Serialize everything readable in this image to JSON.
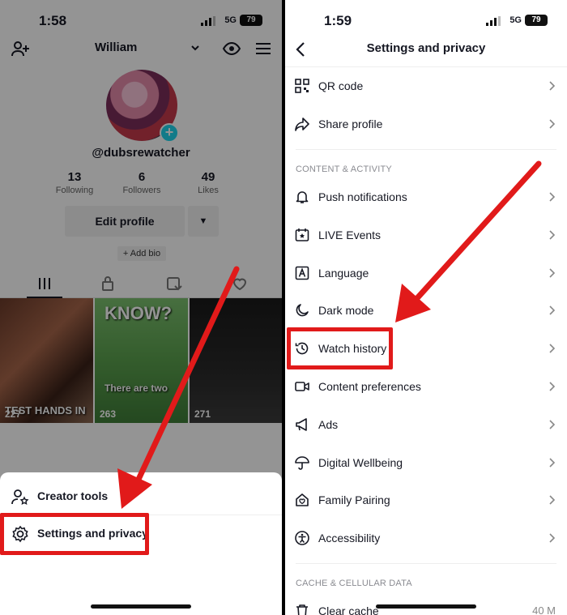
{
  "left": {
    "status": {
      "time": "1:58",
      "network": "5G",
      "battery": "79"
    },
    "username": "William",
    "handle": "@dubsrewatcher",
    "stats": [
      {
        "value": "13",
        "label": "Following"
      },
      {
        "value": "6",
        "label": "Followers"
      },
      {
        "value": "49",
        "label": "Likes"
      }
    ],
    "edit_profile": "Edit profile",
    "add_bio": "+ Add bio",
    "videos": [
      {
        "views": "227",
        "caption": "TEST HANDS IN"
      },
      {
        "views": "263",
        "caption_top": "KNOW?",
        "caption": "There are two"
      },
      {
        "views": "271"
      }
    ],
    "sheet": {
      "creator_tools": "Creator tools",
      "settings_privacy": "Settings and privacy"
    }
  },
  "right": {
    "status": {
      "time": "1:59",
      "network": "5G",
      "battery": "79"
    },
    "title": "Settings and privacy",
    "top_items": [
      {
        "label": "QR code",
        "icon": "qr-code-icon"
      },
      {
        "label": "Share profile",
        "icon": "share-icon"
      }
    ],
    "section_content": "CONTENT & ACTIVITY",
    "content_items": [
      {
        "label": "Push notifications",
        "icon": "bell-icon"
      },
      {
        "label": "LIVE Events",
        "icon": "calendar-star-icon"
      },
      {
        "label": "Language",
        "icon": "language-icon"
      },
      {
        "label": "Dark mode",
        "icon": "moon-icon"
      },
      {
        "label": "Watch history",
        "icon": "history-icon"
      },
      {
        "label": "Content preferences",
        "icon": "video-icon"
      },
      {
        "label": "Ads",
        "icon": "megaphone-icon"
      },
      {
        "label": "Digital Wellbeing",
        "icon": "umbrella-icon"
      },
      {
        "label": "Family Pairing",
        "icon": "house-heart-icon"
      },
      {
        "label": "Accessibility",
        "icon": "accessibility-icon"
      }
    ],
    "section_cache": "CACHE & CELLULAR DATA",
    "clear_cache": {
      "label": "Clear cache",
      "value": "40 M"
    }
  },
  "colors": {
    "highlight": "#e11a1a",
    "accent": "#20d5ec"
  }
}
